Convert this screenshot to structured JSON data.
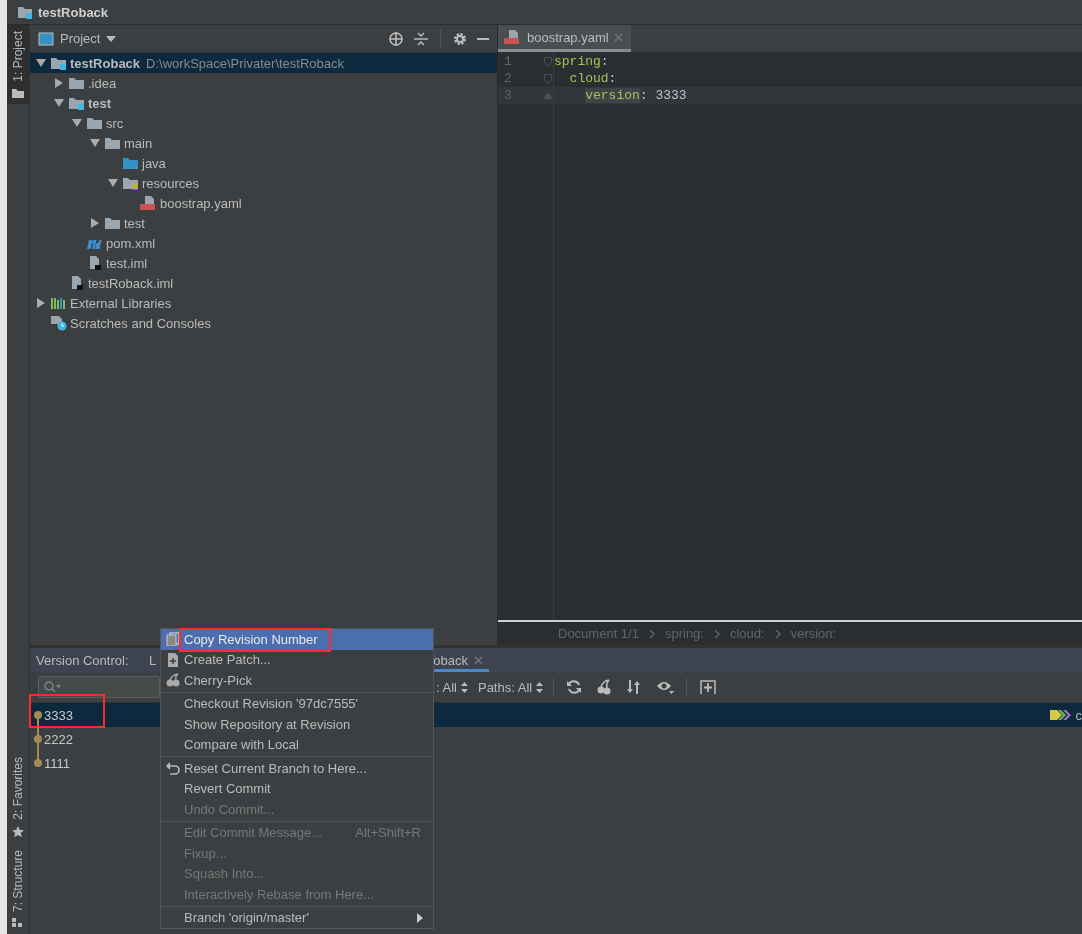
{
  "window": {
    "title": "testRoback"
  },
  "left_stripe": {
    "top": [
      {
        "label": "1: Project",
        "selected": true,
        "kind": "folder"
      }
    ],
    "bottom": [
      {
        "label": "2: Favorites",
        "selected": false,
        "kind": "star"
      },
      {
        "label": "7: Structure",
        "selected": false,
        "kind": "structure"
      }
    ]
  },
  "project": {
    "title": "Project",
    "tree": [
      {
        "label": "testRoback",
        "path": "D:\\workSpace\\Privater\\testRoback",
        "kind": "module",
        "expanded": true,
        "selected": true,
        "children": [
          {
            "label": ".idea",
            "kind": "folder",
            "expanded": false,
            "selected": false
          },
          {
            "label": "test",
            "kind": "module",
            "expanded": true,
            "selected": false,
            "children": [
              {
                "label": "src",
                "kind": "folder",
                "expanded": true,
                "selected": false,
                "children": [
                  {
                    "label": "main",
                    "kind": "folder",
                    "expanded": true,
                    "selected": false,
                    "children": [
                      {
                        "label": "java",
                        "kind": "source",
                        "selected": false
                      },
                      {
                        "label": "resources",
                        "kind": "resources",
                        "expanded": true,
                        "selected": false,
                        "children": [
                          {
                            "label": "boostrap.yaml",
                            "kind": "yaml",
                            "selected": false
                          }
                        ]
                      }
                    ]
                  },
                  {
                    "label": "test",
                    "kind": "folder",
                    "expanded": false,
                    "selected": false
                  }
                ]
              },
              {
                "label": "pom.xml",
                "kind": "maven",
                "selected": false
              },
              {
                "label": "test.iml",
                "kind": "iml",
                "selected": false
              }
            ]
          },
          {
            "label": "testRoback.iml",
            "kind": "iml",
            "selected": false
          }
        ]
      },
      {
        "label": "External Libraries",
        "kind": "libraries",
        "expanded": false,
        "selected": false
      },
      {
        "label": "Scratches and Consoles",
        "kind": "scratches",
        "selected": false
      }
    ]
  },
  "editor": {
    "tabs": [
      {
        "label": "boostrap.yaml",
        "selected": true
      }
    ],
    "yaml": [
      {
        "line": "1",
        "key": "spring",
        "sep": ":",
        "current": false,
        "children": [
          {
            "line": "2",
            "key": "cloud",
            "sep": ":",
            "current": false,
            "children": [
              {
                "line": "3",
                "key": "version",
                "sep": ":",
                "value": "3333",
                "current": true
              }
            ]
          }
        ]
      }
    ],
    "breadcrumbs": [
      "Document 1/1",
      "spring:",
      "cloud:",
      "version:"
    ]
  },
  "version_control": {
    "label": "Version Control:",
    "tabs": [
      {
        "label": "L",
        "selected": false,
        "closable": false
      },
      {
        "label": "oback",
        "selected": true,
        "closable": true
      }
    ],
    "filters": [
      ": All",
      "Paths: All"
    ],
    "commits": [
      {
        "subject": "3333",
        "selected": true,
        "annotated": true,
        "ref": "c"
      },
      {
        "subject": "2222",
        "selected": false,
        "annotated": false
      },
      {
        "subject": "1111",
        "selected": false,
        "annotated": false
      }
    ]
  },
  "context_menu": [
    [
      {
        "label": "Copy Revision Number",
        "selected": true,
        "disabled": false,
        "annotated": true
      },
      {
        "label": "Create Patch...",
        "selected": false,
        "disabled": false,
        "annotated": false
      },
      {
        "label": "Cherry-Pick",
        "selected": false,
        "disabled": false,
        "annotated": false
      }
    ],
    [
      {
        "label": "Checkout Revision '97dc7555'",
        "selected": false,
        "disabled": false,
        "annotated": false
      },
      {
        "label": "Show Repository at Revision",
        "selected": false,
        "disabled": false,
        "annotated": false
      },
      {
        "label": "Compare with Local",
        "selected": false,
        "disabled": false,
        "annotated": false
      }
    ],
    [
      {
        "label": "Reset Current Branch to Here...",
        "selected": false,
        "disabled": false,
        "annotated": false
      },
      {
        "label": "Revert Commit",
        "selected": false,
        "disabled": false,
        "annotated": false
      },
      {
        "label": "Undo Commit...",
        "selected": false,
        "disabled": true,
        "annotated": false
      }
    ],
    [
      {
        "label": "Edit Commit Message...",
        "shortcut": "Alt+Shift+R",
        "selected": false,
        "disabled": true,
        "annotated": false
      },
      {
        "label": "Fixup...",
        "selected": false,
        "disabled": true,
        "annotated": false
      },
      {
        "label": "Squash Into...",
        "selected": false,
        "disabled": true,
        "annotated": false
      },
      {
        "label": "Interactively Rebase from Here...",
        "selected": false,
        "disabled": true,
        "annotated": false
      }
    ],
    [
      {
        "label": "Branch 'origin/master'",
        "submenu": true,
        "selected": false,
        "disabled": false,
        "annotated": false
      }
    ]
  ]
}
